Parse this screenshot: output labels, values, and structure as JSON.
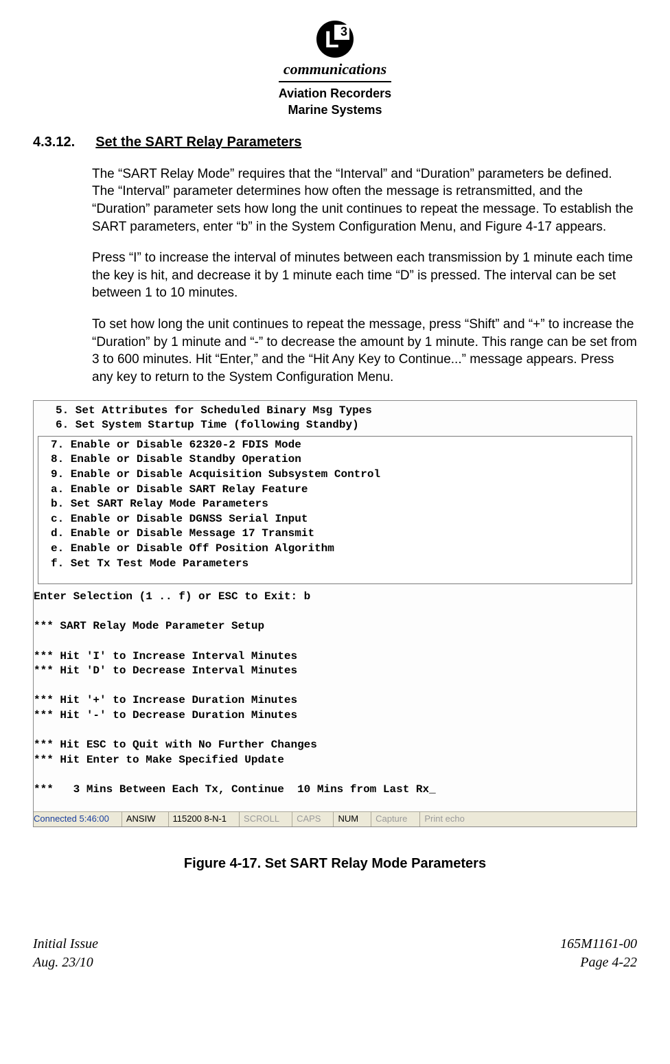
{
  "header": {
    "brand": "communications",
    "sub1": "Aviation Recorders",
    "sub2": "Marine Systems"
  },
  "section": {
    "number": "4.3.12.",
    "title": "Set the SART Relay Parameters"
  },
  "paragraphs": {
    "p1": "The “SART Relay Mode” requires that the “Interval” and “Duration” parameters be defined. The “Interval” parameter determines how often the message is retransmitted, and the “Duration” parameter sets how long the unit continues to repeat the message. To establish the SART parameters, enter “b” in the System Configuration Menu, and Figure 4-17 appears.",
    "p2": "Press “I” to increase the interval of minutes between each transmission by 1 minute each time the key is hit, and decrease it by 1 minute each time “D” is pressed. The interval can be set between 1 to 10 minutes.",
    "p3": "To set how long the unit continues to repeat the message, press “Shift” and “+” to increase the “Duration” by 1 minute and “-” to decrease the amount by 1 minute. This range can be set from 3 to 600 minutes. Hit “Enter,” and the “Hit Any Key to Continue...” message appears. Press any key to return to the System Configuration Menu."
  },
  "terminal": {
    "top": "5. Set Attributes for Scheduled Binary Msg Types\n6. Set System Startup Time (following Standby)",
    "inner": "7. Enable or Disable 62320-2 FDIS Mode\n8. Enable or Disable Standby Operation\n9. Enable or Disable Acquisition Subsystem Control\na. Enable or Disable SART Relay Feature\nb. Set SART Relay Mode Parameters\nc. Enable or Disable DGNSS Serial Input\nd. Enable or Disable Message 17 Transmit\ne. Enable or Disable Off Position Algorithm\nf. Set Tx Test Mode Parameters",
    "bottom": "Enter Selection (1 .. f) or ESC to Exit: b\n\n*** SART Relay Mode Parameter Setup\n\n*** Hit 'I' to Increase Interval Minutes\n*** Hit 'D' to Decrease Interval Minutes\n\n*** Hit '+' to Increase Duration Minutes\n*** Hit '-' to Decrease Duration Minutes\n\n*** Hit ESC to Quit with No Further Changes\n*** Hit Enter to Make Specified Update\n\n***   3 Mins Between Each Tx, Continue  10 Mins from Last Rx_"
  },
  "status": {
    "connected": "Connected 5:46:00",
    "term": "ANSIW",
    "line": "115200 8-N-1",
    "scroll": "SCROLL",
    "caps": "CAPS",
    "num": "NUM",
    "capture": "Capture",
    "echo": "Print echo"
  },
  "figure_caption": "Figure 4-17.  Set SART Relay Mode Parameters",
  "footer": {
    "left1": "Initial Issue",
    "left2": "Aug. 23/10",
    "right1": "165M1161-00",
    "right2": "Page 4-22"
  }
}
